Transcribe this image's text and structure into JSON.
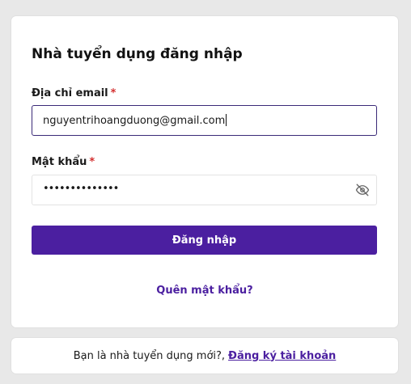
{
  "login_card": {
    "title": "Nhà tuyển dụng đăng nhập",
    "email_label": "Địa chỉ email",
    "password_label": "Mật khẩu",
    "required_mark": "*",
    "email_value": "nguyentrihoangduong@gmail.com",
    "password_value": "••••••••••••••",
    "submit_label": "Đăng nhập",
    "forgot_label": "Quên mật khẩu?"
  },
  "footer": {
    "prompt": "Bạn là nhà tuyển dụng mới?,",
    "register_label": "Đăng ký tài khoản"
  },
  "icons": {
    "password_toggle": "eye-off-icon"
  },
  "colors": {
    "primary": "#4b1fa0",
    "required": "#d32f2f",
    "focus_border": "#3b2a78",
    "background": "#e8e8e8"
  }
}
